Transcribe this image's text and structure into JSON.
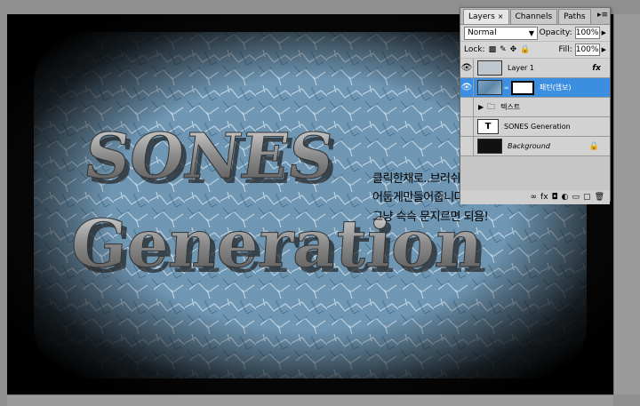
{
  "canvas": {
    "title_line1": "SONES",
    "title_line2": "Generation"
  },
  "annotation": {
    "line1": "클릭한채로..브러쉬로 주위를",
    "line2": "어둡게만들어줍니다",
    "line3": "그냥 슥슥 문지르면 되욤!"
  },
  "layers_panel": {
    "tabs": [
      {
        "label": "Layers",
        "close": "×"
      },
      {
        "label": "Channels"
      },
      {
        "label": "Paths"
      }
    ],
    "menu_icon": "▸≡",
    "blend_mode": "Normal",
    "opacity_label": "Opacity:",
    "opacity_value": "100%",
    "lock_label": "Lock:",
    "fill_label": "Fill:",
    "fill_value": "100%",
    "layers": [
      {
        "name": "Layer 1",
        "badge": "fx"
      },
      {
        "name": "패턴(엠보)",
        "selected": true
      },
      {
        "name": "텍스트"
      },
      {
        "name": "SONES  Generation",
        "thumb": "T"
      },
      {
        "name": "Background",
        "italic": true,
        "lock": "🔒"
      }
    ],
    "footer_icons": [
      "link-icon",
      "fx-icon",
      "mask-icon",
      "adjustment-icon",
      "folder-icon",
      "new-layer-icon",
      "trash-icon"
    ],
    "footer_glyphs": [
      "∞",
      "fx",
      "◘",
      "◐",
      "▭",
      "▢",
      "🗑"
    ]
  },
  "colors": {
    "highlight": "#3c8ee0",
    "arrow": "#e8505f"
  }
}
